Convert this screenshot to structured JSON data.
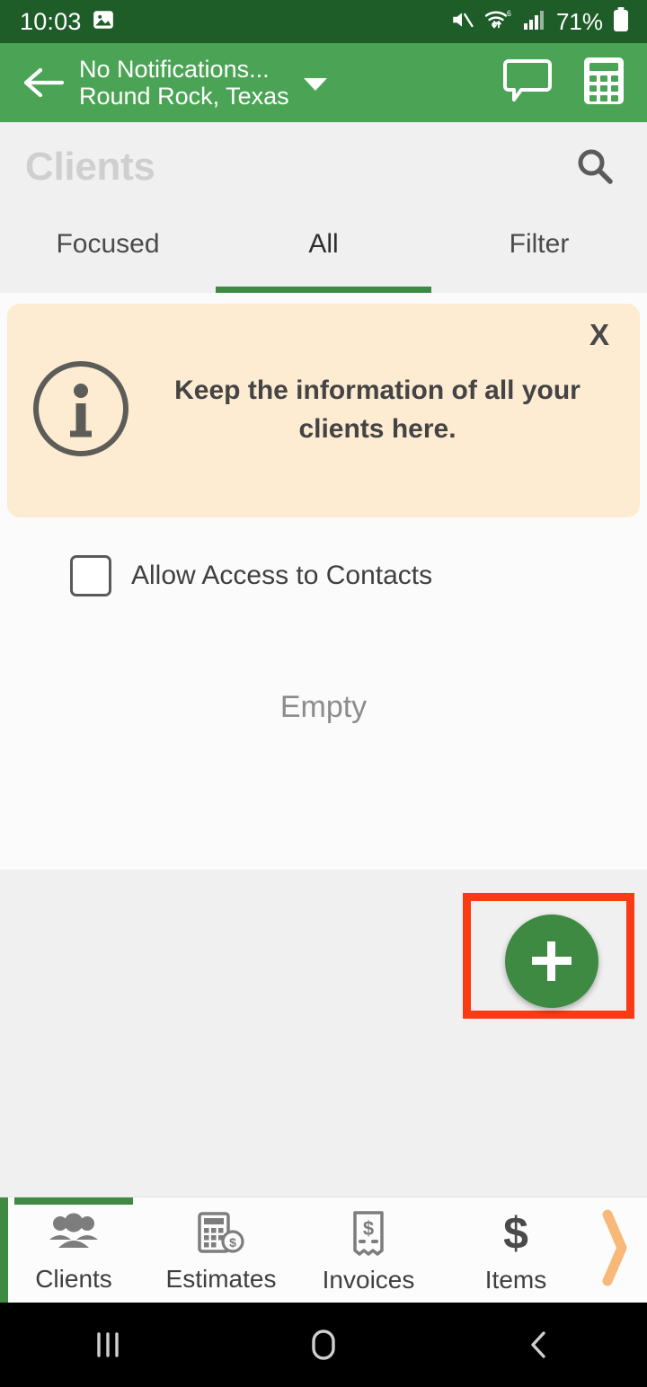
{
  "status_bar": {
    "time": "10:03",
    "battery_percent": "71%",
    "icons": [
      "image-notification-icon",
      "mute-icon",
      "wifi-6-icon",
      "cellular-signal-icon",
      "battery-icon"
    ],
    "background_color": "#1e5c28"
  },
  "app_bar": {
    "back_label": "back-arrow",
    "title_line1": "No Notifications...",
    "title_line2": "Round Rock, Texas",
    "dropdown": "chevron-down-icon",
    "actions": [
      "chat-icon",
      "calculator-icon"
    ],
    "background_color": "#4ba455"
  },
  "page_header": {
    "title": "Clients",
    "search_icon": "search-icon",
    "title_color": "#cfcfcf"
  },
  "tabs": {
    "active_index": 1,
    "accent_color": "#3f8a43",
    "items": [
      {
        "label": "Focused"
      },
      {
        "label": "All"
      },
      {
        "label": "Filter"
      }
    ]
  },
  "banner": {
    "icon": "info-circle-icon",
    "message": "Keep the information of all your clients here.",
    "close_label": "X",
    "background_color": "#fdebd2"
  },
  "contacts_permission": {
    "label": "Allow Access to Contacts",
    "checked": false
  },
  "list": {
    "empty_label": "Empty"
  },
  "fab": {
    "icon": "plus-icon",
    "color": "#3f8a43",
    "highlight_color": "#f93a12"
  },
  "bottom_nav": {
    "active_index": 0,
    "accent_color": "#3f8a43",
    "more_icon": "chevron-right-icon",
    "more_icon_color": "#f8b878",
    "items": [
      {
        "label": "Clients",
        "icon": "people-group-icon"
      },
      {
        "label": "Estimates",
        "icon": "calculator-dollar-icon"
      },
      {
        "label": "Invoices",
        "icon": "receipt-dollar-icon"
      },
      {
        "label": "Items",
        "icon": "dollar-sign-icon"
      }
    ]
  },
  "android_nav": {
    "recents": "recents-icon",
    "home": "home-icon",
    "back": "back-icon"
  }
}
